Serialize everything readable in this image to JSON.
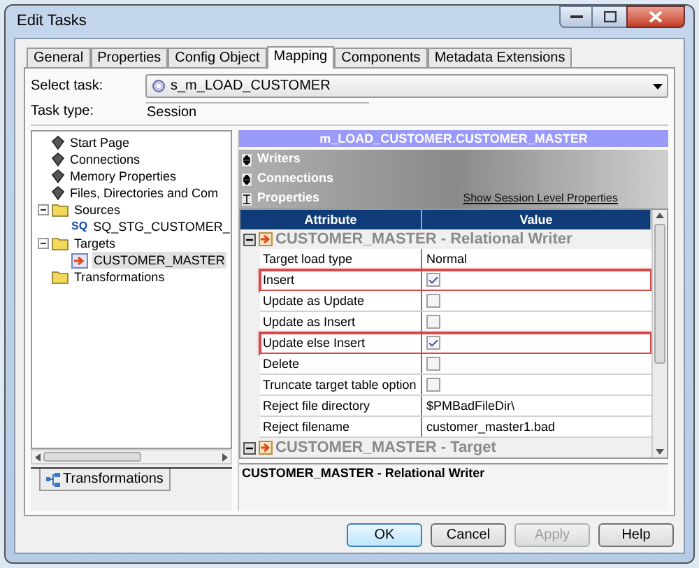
{
  "window": {
    "title": "Edit Tasks"
  },
  "tabs": [
    {
      "label": "General",
      "selected": false
    },
    {
      "label": "Properties",
      "selected": false
    },
    {
      "label": "Config Object",
      "selected": false
    },
    {
      "label": "Mapping",
      "selected": true
    },
    {
      "label": "Components",
      "selected": false
    },
    {
      "label": "Metadata Extensions",
      "selected": false
    }
  ],
  "select_task": {
    "label": "Select task:",
    "value": "s_m_LOAD_CUSTOMER"
  },
  "task_type": {
    "label": "Task type:",
    "value": "Session"
  },
  "tree": [
    {
      "label": "Start Page",
      "kind": "page",
      "selected": false
    },
    {
      "label": "Connections",
      "kind": "page",
      "selected": false
    },
    {
      "label": "Memory Properties",
      "kind": "page",
      "selected": false
    },
    {
      "label": "Files, Directories and Com",
      "kind": "page",
      "selected": false
    },
    {
      "label": "Sources",
      "kind": "folder",
      "selected": false,
      "expanded": true,
      "children": [
        {
          "label": "SQ_STG_CUSTOMER_",
          "kind": "source",
          "icon_label": "SQ",
          "selected": false
        }
      ]
    },
    {
      "label": "Targets",
      "kind": "folder",
      "selected": false,
      "expanded": true,
      "children": [
        {
          "label": "CUSTOMER_MASTER",
          "kind": "target",
          "selected": true
        }
      ]
    },
    {
      "label": "Transformations",
      "kind": "folder",
      "selected": false
    }
  ],
  "left_tabs": [
    {
      "label": "Transformations",
      "selected": true
    }
  ],
  "mapping_title": "m_LOAD_CUSTOMER.CUSTOMER_MASTER",
  "sections": [
    {
      "label": "Writers",
      "expanded": false
    },
    {
      "label": "Connections",
      "expanded": false
    },
    {
      "label": "Properties",
      "expanded": true
    }
  ],
  "session_link": "Show Session Level Properties",
  "table": {
    "columns": [
      "Attribute",
      "Value"
    ],
    "groups": [
      {
        "title": "CUSTOMER_MASTER - Relational Writer",
        "expanded": true,
        "rows": [
          {
            "attribute": "Target load type",
            "kind": "text",
            "value": "Normal",
            "highlighted": false
          },
          {
            "attribute": "Insert",
            "kind": "checkbox",
            "checked": true,
            "highlighted": true
          },
          {
            "attribute": "Update as Update",
            "kind": "checkbox",
            "checked": false,
            "highlighted": false
          },
          {
            "attribute": "Update as Insert",
            "kind": "checkbox",
            "checked": false,
            "highlighted": false
          },
          {
            "attribute": "Update else Insert",
            "kind": "checkbox",
            "checked": true,
            "highlighted": true
          },
          {
            "attribute": "Delete",
            "kind": "checkbox",
            "checked": false,
            "highlighted": false
          },
          {
            "attribute": "Truncate target table option",
            "kind": "checkbox",
            "checked": false,
            "highlighted": false
          },
          {
            "attribute": "Reject file directory",
            "kind": "text",
            "value": "$PMBadFileDir\\",
            "highlighted": false
          },
          {
            "attribute": "Reject filename",
            "kind": "text",
            "value": "customer_master1.bad",
            "highlighted": false
          }
        ]
      },
      {
        "title": "CUSTOMER_MASTER - Target",
        "expanded": true
      }
    ]
  },
  "description": "CUSTOMER_MASTER - Relational Writer",
  "buttons": [
    {
      "label": "OK",
      "default": true,
      "disabled": false
    },
    {
      "label": "Cancel",
      "default": false,
      "disabled": false
    },
    {
      "label": "Apply",
      "default": false,
      "disabled": true
    },
    {
      "label": "Help",
      "default": false,
      "disabled": false
    }
  ]
}
